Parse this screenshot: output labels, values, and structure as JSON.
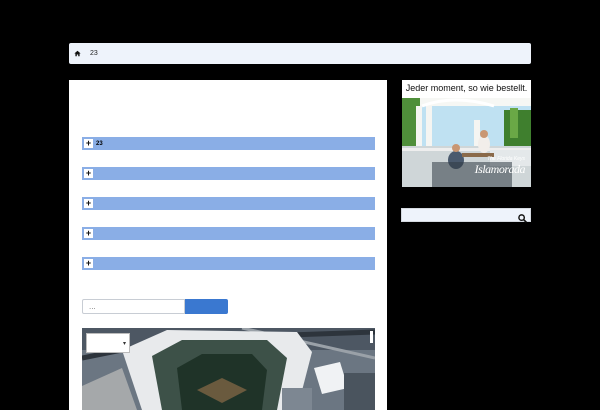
{
  "breadcrumb": {
    "home_icon": "home-icon",
    "current": "23"
  },
  "accordion": {
    "items": [
      {
        "label": "23"
      },
      {
        "label": ""
      },
      {
        "label": ""
      },
      {
        "label": ""
      },
      {
        "label": ""
      }
    ],
    "toggle_symbol": "+"
  },
  "mini_form": {
    "placeholder": "...",
    "button_label": ""
  },
  "map": {
    "select_value": ""
  },
  "ad": {
    "headline": "Jeder moment, so wie bestellt.",
    "logo_small": "The Florida Keys",
    "logo": "Islamorada"
  },
  "sidebar_search": {
    "icon": "search-icon"
  },
  "colors": {
    "accordion_bar": "#8aaee6",
    "button": "#3a78d0",
    "breadcrumb_bg": "#eef3fb"
  }
}
